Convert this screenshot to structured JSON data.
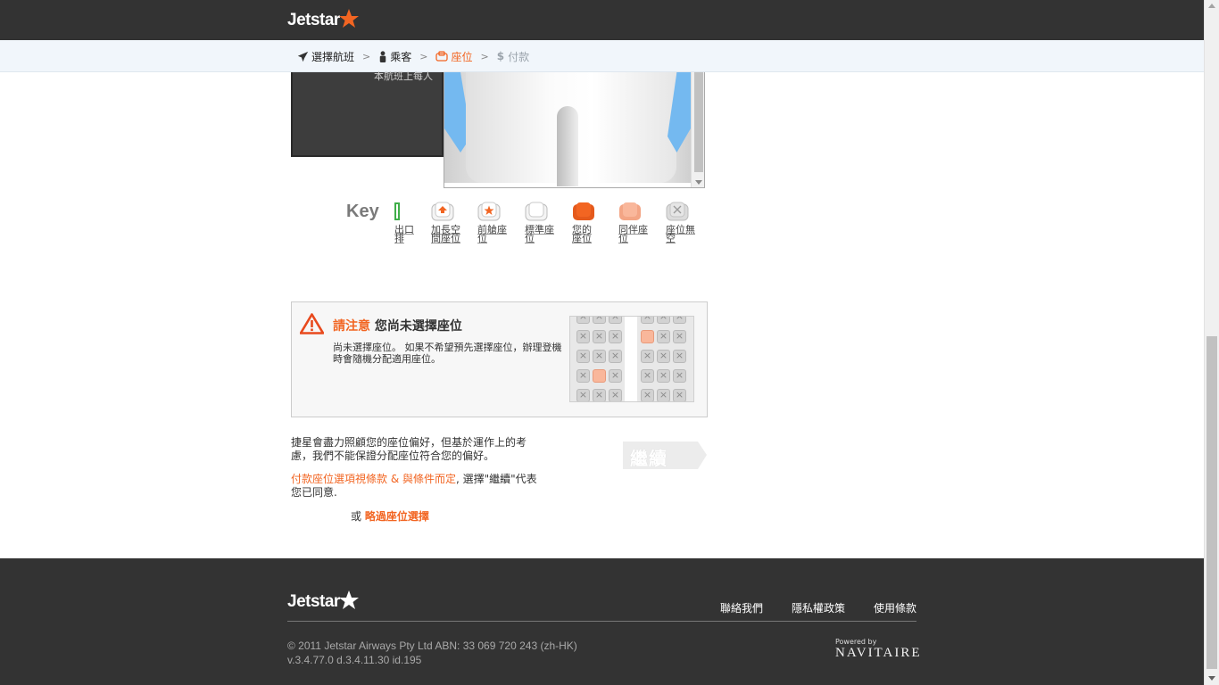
{
  "header": {
    "logo_text": "Jetstar"
  },
  "breadcrumb": [
    {
      "label": "選擇航班",
      "state": "done"
    },
    {
      "label": "乘客",
      "state": "done"
    },
    {
      "label": "座位",
      "state": "active"
    },
    {
      "label": "付款",
      "state": "disabled"
    }
  ],
  "fare_box": {
    "text": "本航班上每人"
  },
  "key": {
    "title": "Key",
    "items": [
      {
        "label": "出口排"
      },
      {
        "label": "加長空間座位"
      },
      {
        "label": "前艙座位"
      },
      {
        "label": "標準座位"
      },
      {
        "label": "您的座位"
      },
      {
        "label": "同伴座位"
      },
      {
        "label": "座位無空"
      }
    ]
  },
  "warning": {
    "title_highlight": "請注意",
    "title_rest": "您尚未選擇座位",
    "body": "尚未選擇座位。 如果不希望預先選擇座位，辦理登機時會隨機分配適用座位。",
    "unavailable_mark": "×"
  },
  "notes": {
    "preference": "捷星會盡力照顧您的座位偏好，但基於運作上的考慮，我們不能保證分配座位符合您的偏好。",
    "terms_link": "付款座位選項視條款 & 與條件而定",
    "terms_rest": ", 選擇\"繼續\"代表您已同意.",
    "skip_prefix": "或",
    "skip_link": "略過座位選擇"
  },
  "continue_button": {
    "label": "繼續"
  },
  "footer": {
    "logo_text": "Jetstar",
    "links": [
      "聯絡我們",
      "隱私權政策",
      "使用條款"
    ],
    "copyright": "© 2011 Jetstar Airways Pty Ltd ABN: 33 069 720 243 (zh-HK)",
    "version": "v.3.4.77.0 d.3.4.11.30  id.195",
    "powered_by": "Powered by",
    "powered_brand": "NAVITAIRE"
  },
  "colors": {
    "accent": "#f26522",
    "dark_bar": "#333333",
    "breadcrumb_bg": "#f1f6fb",
    "exit_row": "#3fae49",
    "your_seat": "#f26522",
    "companion_seat": "#f9b79b"
  }
}
